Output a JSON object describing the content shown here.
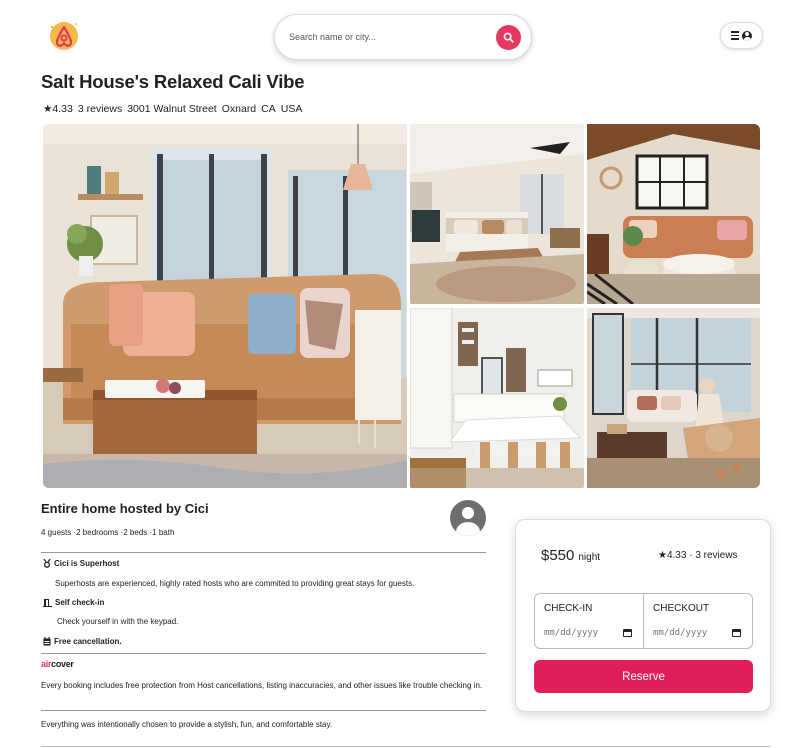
{
  "search": {
    "placeholder": "Search name or city..."
  },
  "listing": {
    "title": "Salt House's Relaxed Cali Vibe",
    "rating": "★4.33",
    "reviews": "3 reviews",
    "address": [
      "3001 Walnut Street",
      "Oxnard",
      "CA",
      "USA"
    ]
  },
  "host": {
    "title": "Entire home hosted by Cici",
    "details": "4 guests ·2 bedrooms ·2 beds ·1 bath"
  },
  "features": [
    {
      "icon": "medal-icon",
      "title": "Cici is Superhost",
      "desc": "Superhosts are experienced, highly rated hosts who are commited to providing great stays for guests."
    },
    {
      "icon": "door-icon",
      "title": "Self check-in",
      "desc": "Check yourself in with the keypad."
    },
    {
      "icon": "calendar-icon",
      "title": "Free cancellation."
    }
  ],
  "aircover": {
    "prefix": "air",
    "suffix": "cover",
    "desc": "Every booking includes free protection from Host cancellations, listing inaccuracies, and other issues like trouble checking in."
  },
  "summary": "Everything was intentionally chosen to provide a stylish, fun, and comfortable stay.",
  "booking": {
    "price": "$550",
    "unit": "night",
    "rating": "★4.33 · 3 reviews",
    "checkin_label": "CHECK-IN",
    "checkout_label": "CHECKOUT",
    "date_placeholder": "mm/dd/yyyy",
    "reserve_label": "Reserve"
  },
  "colors": {
    "brand": "#e01e5a",
    "search_button": "#e5375f"
  },
  "photos": [
    "living-room-photo",
    "bedroom-photo",
    "lounge-photo",
    "kitchen-photo",
    "family-room-photo"
  ]
}
